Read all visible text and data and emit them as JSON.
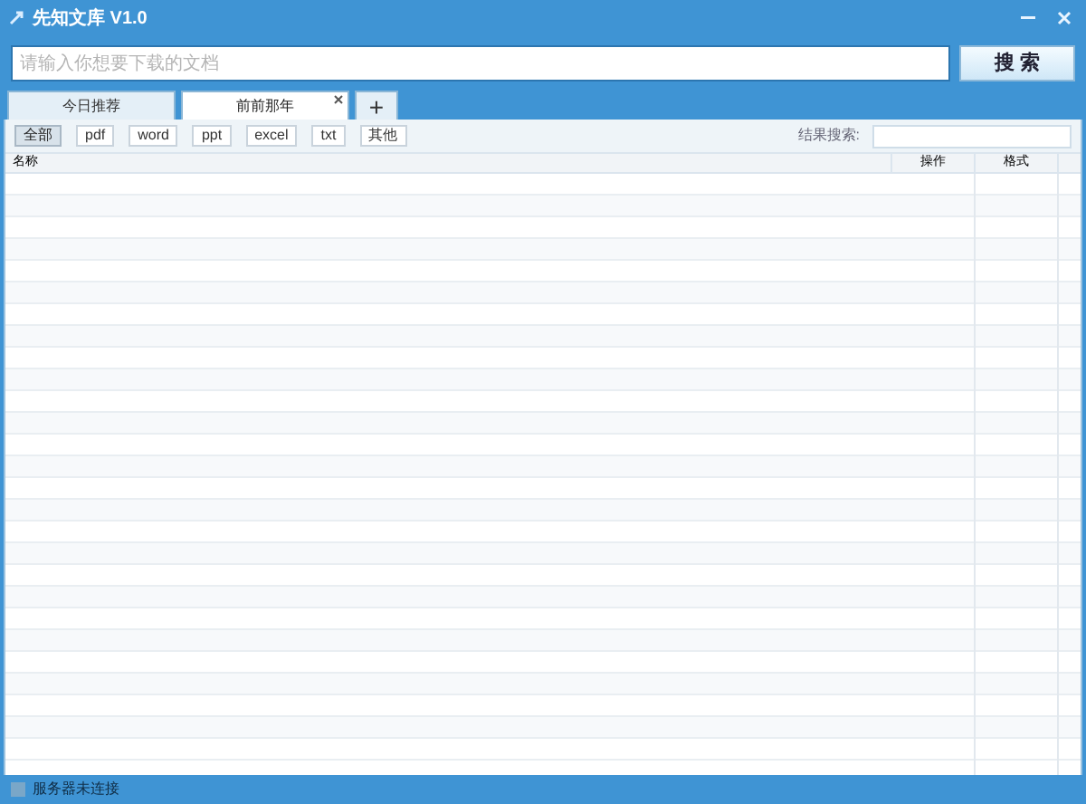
{
  "window": {
    "title": "先知文库 V1.0"
  },
  "search": {
    "placeholder": "请输入你想要下载的文档",
    "button": "搜 索"
  },
  "tabs": [
    {
      "label": "今日推荐",
      "selected": false,
      "closable": false
    },
    {
      "label": "前前那年",
      "selected": true,
      "closable": true
    }
  ],
  "add_tab": "+",
  "filters": [
    {
      "label": "全部",
      "selected": true
    },
    {
      "label": "pdf",
      "selected": false
    },
    {
      "label": "word",
      "selected": false
    },
    {
      "label": "ppt",
      "selected": false
    },
    {
      "label": "excel",
      "selected": false
    },
    {
      "label": "txt",
      "selected": false
    },
    {
      "label": "其他",
      "selected": false
    }
  ],
  "result_search": {
    "label": "结果搜索:"
  },
  "table": {
    "columns": [
      "名称",
      "操作",
      "格式"
    ]
  },
  "status_bar": {
    "text": "服务器未连接"
  }
}
